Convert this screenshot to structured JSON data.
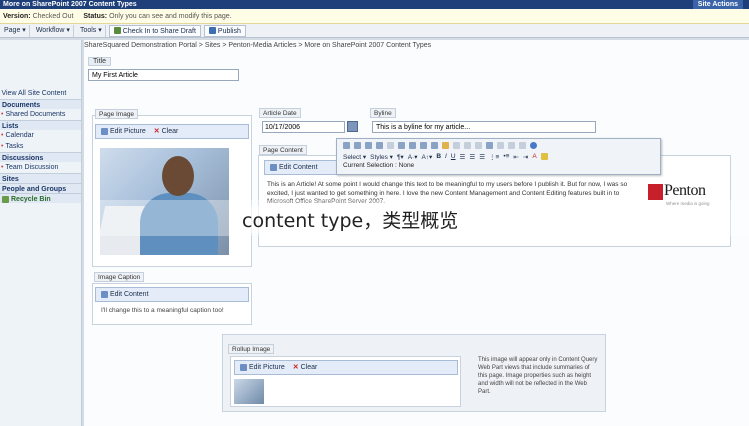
{
  "topbar": {
    "title": "More on SharePoint 2007 Content Types",
    "site_actions": "Site Actions"
  },
  "status": {
    "version_label": "Version:",
    "version_value": "Checked Out",
    "status_label": "Status:",
    "status_value": "Only you can see and modify this page."
  },
  "toolbar": {
    "page": "Page",
    "workflow": "Workflow",
    "tools": "Tools",
    "checkin": "Check In to Share Draft",
    "publish": "Publish"
  },
  "breadcrumb": "ShareSquared Demonstration Portal > Sites > Penton-Media Articles > More on SharePoint 2007 Content Types",
  "nav": {
    "view_all": "View All Site Content",
    "documents": "Documents",
    "shared_documents": "Shared Documents",
    "lists": "Lists",
    "calendar": "Calendar",
    "tasks": "Tasks",
    "discussions": "Discussions",
    "team_discussion": "Team Discussion",
    "sites": "Sites",
    "people": "People and Groups",
    "recycle": "Recycle Bin"
  },
  "form": {
    "title_label": "Title",
    "title_value": "My First Article",
    "page_image_label": "Page Image",
    "edit_picture": "Edit Picture",
    "clear": "Clear",
    "date_label": "Article Date",
    "date_value": "10/17/2006",
    "byline_label": "Byline",
    "byline_value": "This is a byline for my article...",
    "page_content_label": "Page Content",
    "edit_content": "Edit Content",
    "content_text": "This is an Article! At some point I would change this text to be meaningful to my users before I publish it. But for now, I was so excited, I just wanted to get something in here. I love the new Content Management and Content Editing features built in to Microsoft Office SharePoint Server 2007.",
    "caption_label": "Image Caption",
    "caption_text": "I'll change this to a meaningful caption too!",
    "rollup_label": "Rollup Image",
    "rollup_note": "This image will appear only in Content Query Web Part views that include summaries of this page. Image properties such as height and width will not be reflected in the Web Part."
  },
  "rte": {
    "select": "Select",
    "styles": "Styles",
    "current_selection": "Current Selection : None"
  },
  "logo": {
    "name": "Penton",
    "tagline": "Where media is going"
  },
  "overlay": "content type，类型概览",
  "colors": {
    "topbar": "#1f3f7a",
    "status_bg": "#fffde6",
    "nav_bg": "#eef3f8",
    "edit_bar": "#e3ecf8",
    "penton_red": "#c8202a"
  }
}
